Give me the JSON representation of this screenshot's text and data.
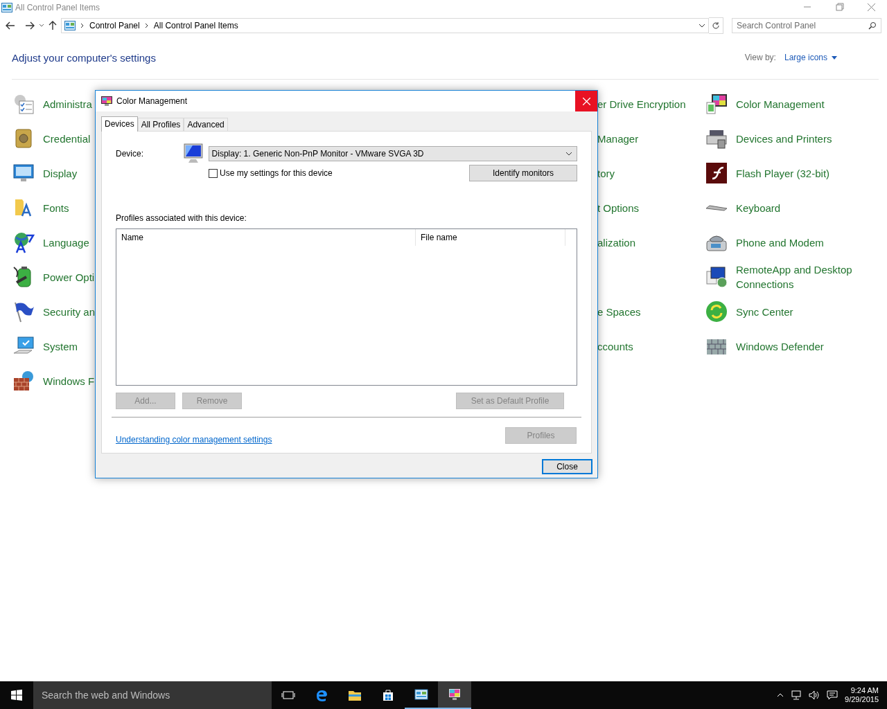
{
  "window": {
    "title": "All Control Panel Items"
  },
  "address_bar": {
    "breadcrumbs": [
      "Control Panel",
      "All Control Panel Items"
    ]
  },
  "search": {
    "placeholder": "Search Control Panel"
  },
  "header": {
    "title": "Adjust your computer's settings",
    "view_by_label": "View by:",
    "view_by_value": "Large icons"
  },
  "items": [
    {
      "left": "Administra",
      "middle": "er Drive Encryption",
      "right": "Color Management"
    },
    {
      "left": "Credential",
      "middle": "Manager",
      "right": "Devices and Printers"
    },
    {
      "left": "Display",
      "middle": "tory",
      "right": "Flash Player (32-bit)"
    },
    {
      "left": "Fonts",
      "middle": "t Options",
      "right": "Keyboard"
    },
    {
      "left": "Language",
      "middle": "alization",
      "right": "Phone and Modem"
    },
    {
      "left": "Power Opti",
      "right": "RemoteApp and Desktop Connections"
    },
    {
      "left": "Security an",
      "middle": "e Spaces",
      "right": "Sync Center"
    },
    {
      "left": "System",
      "middle": "ccounts",
      "right": "Windows Defender"
    },
    {
      "left": "Windows F"
    }
  ],
  "dialog": {
    "title": "Color Management",
    "tabs": [
      {
        "label": "Devices",
        "selected": true
      },
      {
        "label": "All Profiles",
        "selected": false
      },
      {
        "label": "Advanced",
        "selected": false
      }
    ],
    "device_label": "Device:",
    "device_value": "Display: 1. Generic Non-PnP Monitor - VMware SVGA 3D",
    "use_my_settings": {
      "label": "Use my settings for this device",
      "checked": false
    },
    "identify_button": {
      "label": "Identify monitors",
      "disabled": false
    },
    "profiles_label": "Profiles associated with this device:",
    "columns": [
      "Name",
      "File name"
    ],
    "list_buttons": [
      {
        "label": "Add...",
        "disabled": true
      },
      {
        "label": "Remove",
        "disabled": true
      },
      {
        "label": "Set as Default Profile",
        "disabled": true
      }
    ],
    "link": "Understanding color management settings",
    "profiles_button": {
      "label": "Profiles",
      "disabled": true
    },
    "close_button": {
      "label": "Close",
      "disabled": false
    }
  },
  "taskbar": {
    "search_placeholder": "Search the web and Windows",
    "apps": [
      {
        "running": false,
        "selected": false
      },
      {
        "running": false,
        "selected": false
      },
      {
        "running": false,
        "selected": false
      },
      {
        "running": false,
        "selected": false
      },
      {
        "running": true,
        "selected": false
      },
      {
        "running": true,
        "selected": true
      }
    ],
    "time": "9:24 AM",
    "date": "9/29/2015"
  }
}
